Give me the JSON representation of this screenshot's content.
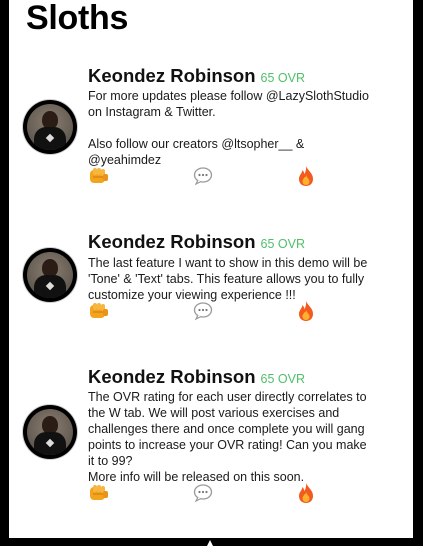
{
  "page": {
    "title": "Sloths"
  },
  "posts": [
    {
      "author": "Keondez Robinson",
      "rating": "65 OVR",
      "lines": [
        "For more updates please follow @LazySlothStudio",
        "on Instagram & Twitter.",
        "",
        "Also follow our creators @ltsopher__ &",
        "@yeahimdez"
      ]
    },
    {
      "author": "Keondez Robinson",
      "rating": "65 OVR",
      "lines": [
        "The last feature I want to show in this demo will be",
        "'Tone' & 'Text' tabs. This feature allows you to fully",
        "customize your viewing experience !!!"
      ]
    },
    {
      "author": "Keondez Robinson",
      "rating": "65 OVR",
      "lines": [
        "The OVR rating for each user directly correlates to",
        "the W tab. We will post various exercises and",
        "challenges there and once complete you will gang",
        "points to increase your OVR rating! Can you make",
        "it to 99?",
        "More info will be released on this soon."
      ]
    }
  ],
  "actions": {
    "dap_icon": "fist-bump-icon",
    "comment_icon": "speech-bubble-icon",
    "fire_icon": "fire-icon"
  },
  "colors": {
    "ovr_green": "#4fbf6a",
    "fist_orange": "#f4a41c",
    "fire_red": "#f25a1e",
    "comment_gray": "#9a9a9a"
  }
}
